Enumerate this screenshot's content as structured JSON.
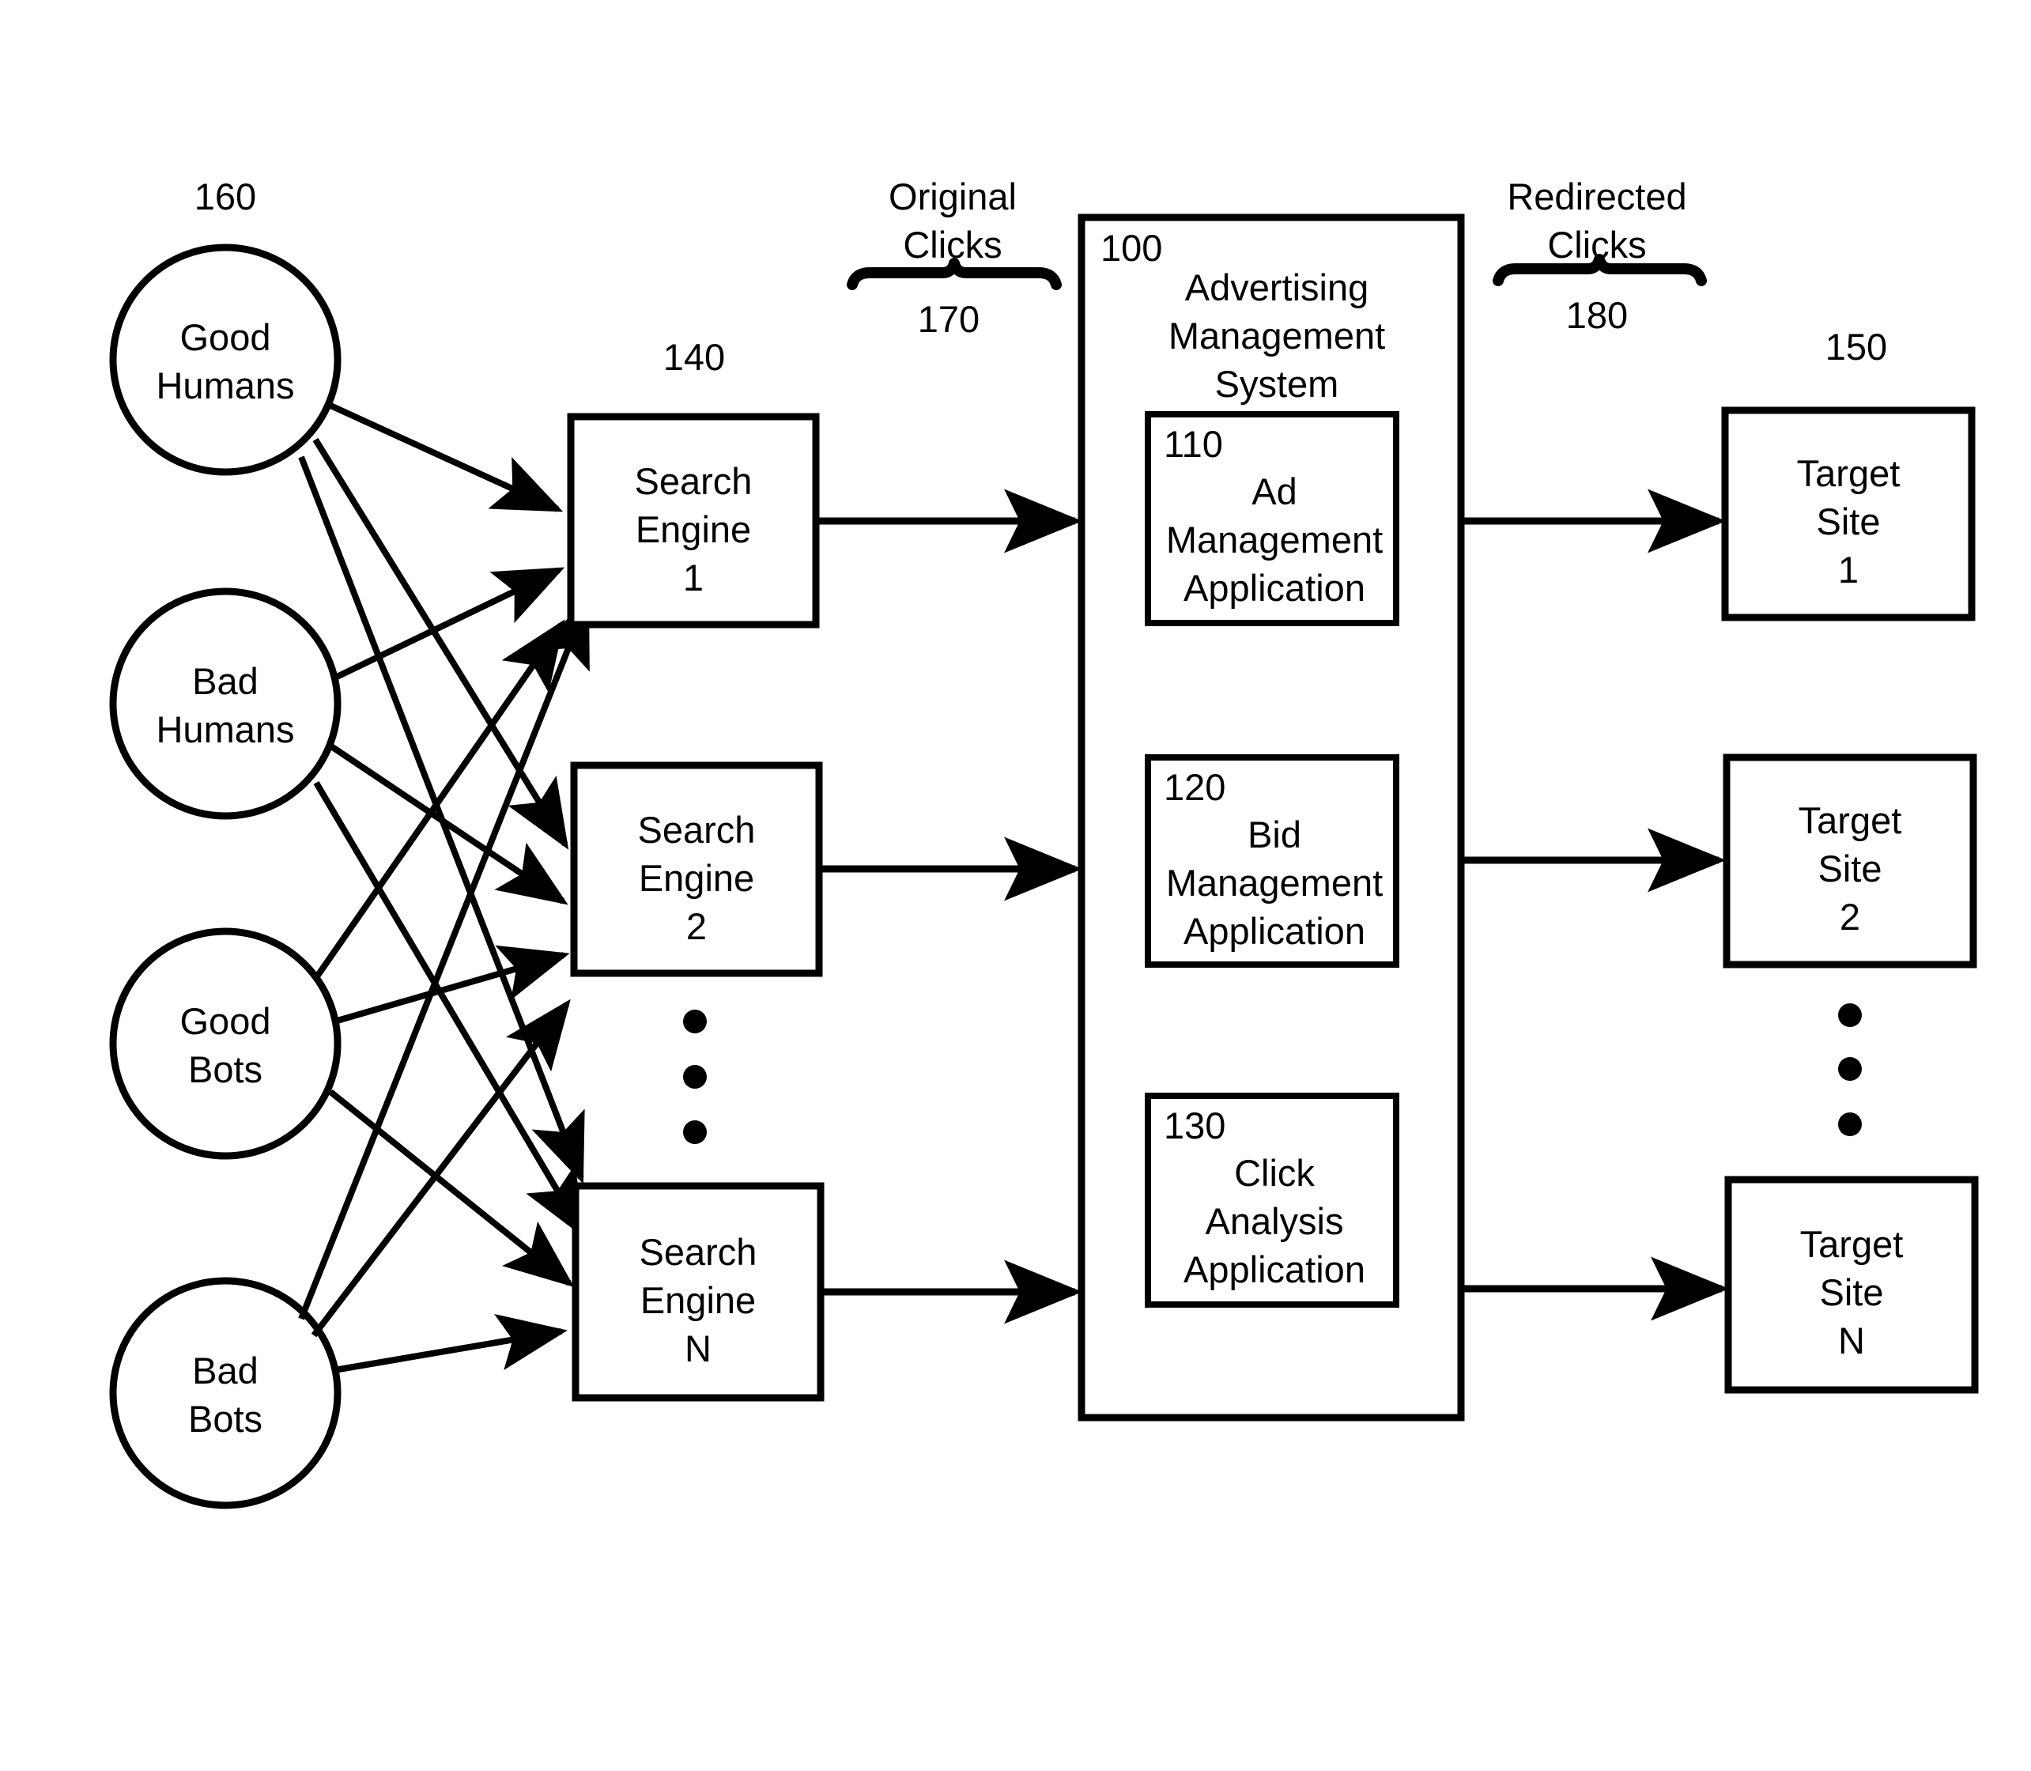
{
  "figure": {
    "title": "Advertising click redirection system block diagram",
    "sources": {
      "ref": "160",
      "items": [
        {
          "line1": "Good",
          "line2": "Humans"
        },
        {
          "line1": "Bad",
          "line2": "Humans"
        },
        {
          "line1": "Good",
          "line2": "Bots"
        },
        {
          "line1": "Bad",
          "line2": "Bots"
        }
      ]
    },
    "search_engines": {
      "ref": "140",
      "items": [
        {
          "line1": "Search",
          "line2": "Engine",
          "line3": "1"
        },
        {
          "line1": "Search",
          "line2": "Engine",
          "line3": "2"
        },
        {
          "line1": "Search",
          "line2": "Engine",
          "line3": "N"
        }
      ],
      "ellipsis": "•"
    },
    "original_clicks": {
      "label_line1": "Original",
      "label_line2": "Clicks",
      "ref": "170"
    },
    "redirected_clicks": {
      "label_line1": "Redirected",
      "label_line2": "Clicks",
      "ref": "180"
    },
    "ad_management_system": {
      "ref": "100",
      "title_line1": "Advertising",
      "title_line2": "Management",
      "title_line3": "System",
      "applications": [
        {
          "ref": "110",
          "line1": "Ad",
          "line2": "Management",
          "line3": "Application"
        },
        {
          "ref": "120",
          "line1": "Bid",
          "line2": "Management",
          "line3": "Application"
        },
        {
          "ref": "130",
          "line1": "Click",
          "line2": "Analysis",
          "line3": "Application"
        }
      ]
    },
    "target_sites": {
      "ref": "150",
      "items": [
        {
          "line1": "Target",
          "line2": "Site",
          "line3": "1"
        },
        {
          "line1": "Target",
          "line2": "Site",
          "line3": "2"
        },
        {
          "line1": "Target",
          "line2": "Site",
          "line3": "N"
        }
      ],
      "ellipsis": "•"
    },
    "colors": {
      "stroke": "#000000",
      "background": "#ffffff"
    }
  }
}
